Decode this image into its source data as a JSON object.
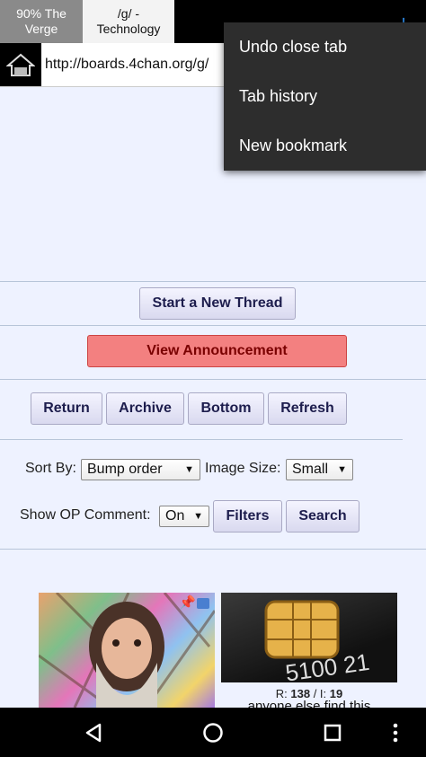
{
  "tabs": [
    {
      "label": "90% The\nVerge",
      "active": false
    },
    {
      "label": "/g/ -\nTechnology",
      "active": true
    }
  ],
  "url": "http://boards.4chan.org/g/",
  "menu": {
    "items": [
      "Undo close tab",
      "Tab history",
      "New bookmark"
    ]
  },
  "board": {
    "new_thread_label": "Start a New Thread",
    "announcement_label": "View Announcement",
    "nav_buttons": [
      "Return",
      "Archive",
      "Bottom",
      "Refresh"
    ],
    "sort_by_label": "Sort By:",
    "sort_by_value": "Bump order",
    "image_size_label": "Image Size:",
    "image_size_value": "Small",
    "show_op_label": "Show OP Comment:",
    "show_op_value": "On",
    "filters_label": "Filters",
    "search_label": "Search"
  },
  "threads": [
    {
      "thumb": "stallman-portrait"
    },
    {
      "thumb": "chip-card",
      "card_number": "5100 21",
      "replies_label": "R:",
      "replies": "138",
      "images_label": "I:",
      "images": "19",
      "excerpt": "anyone else find this"
    }
  ],
  "colors": {
    "page_bg": "#eef2ff",
    "accent": "#2a7fd4",
    "announcement_bg": "#f38080"
  }
}
